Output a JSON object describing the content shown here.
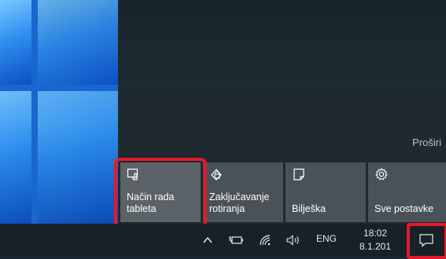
{
  "action_center": {
    "expand_label": "Proširi",
    "tiles": [
      {
        "label": "Način rada\ntableta",
        "icon": "tablet-mode-icon"
      },
      {
        "label": "Zaključavanje\nrotiranja",
        "icon": "rotation-lock-icon"
      },
      {
        "label": "Bilješka",
        "icon": "note-icon"
      },
      {
        "label": "Sve postavke",
        "icon": "gear-icon"
      }
    ]
  },
  "taskbar": {
    "language": "ENG",
    "time": "18:02",
    "date": "8.1.201",
    "icons": [
      "chevron-up-icon",
      "battery-icon",
      "wifi-icon",
      "volume-icon",
      "notification-icon"
    ]
  },
  "colors": {
    "highlight": "#e5192a",
    "tile_bg": "#4a5258",
    "taskbar_bg": "#172128"
  }
}
